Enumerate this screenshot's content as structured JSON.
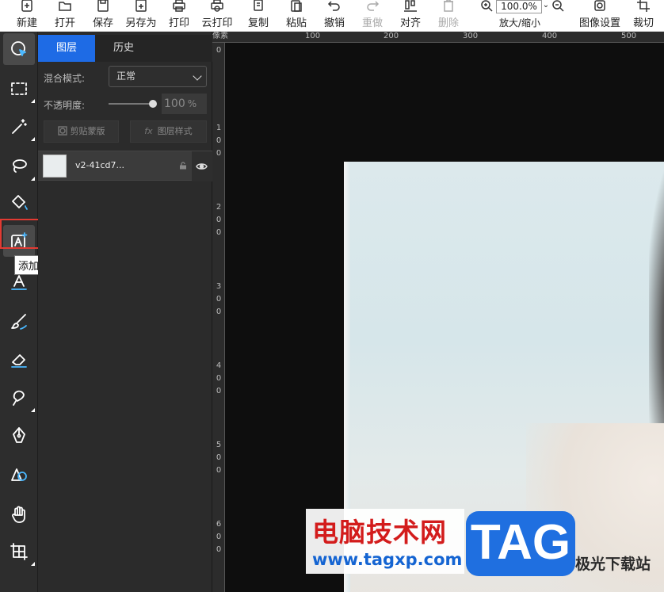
{
  "toolbar": {
    "new": "新建",
    "open": "打开",
    "save": "保存",
    "save_as": "另存为",
    "print": "打印",
    "cloud_print": "云打印",
    "copy": "复制",
    "paste": "粘贴",
    "undo": "撤销",
    "redo": "重做",
    "align": "对齐",
    "delete": "删除",
    "zoom_value": "100.0%",
    "zoom_label": "放大/缩小",
    "image_settings": "图像设置",
    "crop": "裁切"
  },
  "tooltip": {
    "text": "添加文字(Ｔ)"
  },
  "panel": {
    "tabs": [
      "图层",
      "历史"
    ],
    "blend_label": "混合模式:",
    "blend_value": "正常",
    "opacity_label": "不透明度:",
    "opacity_value": "100",
    "opacity_unit": "%",
    "opacity_percent": 100,
    "clip_mask": "剪贴蒙版",
    "layer_style": "图层样式",
    "layer_name": "v2-41cd7..."
  },
  "ruler": {
    "unit": "像素",
    "top_ticks": [
      "100",
      "200",
      "300",
      "400",
      "500"
    ],
    "left_ticks": [
      "0",
      "1\n0\n0",
      "2\n0\n0",
      "3\n0\n0",
      "4\n0\n0",
      "5\n0\n0",
      "6\n0\n0"
    ]
  },
  "watermark": {
    "title": "电脑技术网",
    "url": "www.tagxp.com",
    "tag": "TAG",
    "aside": "极光下载站"
  },
  "colors": {
    "accent": "#1e6be5",
    "highlight": "#e23a32",
    "tag_blue": "#1f6fe0"
  }
}
